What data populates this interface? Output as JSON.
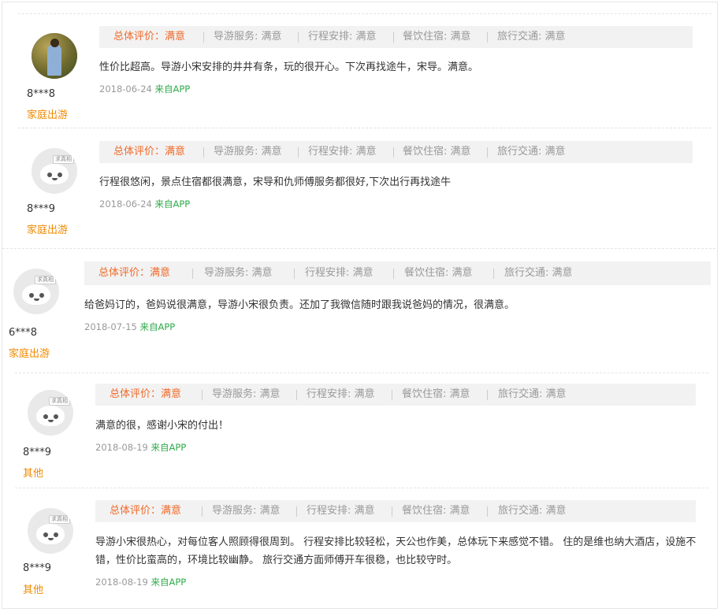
{
  "reviews": [
    {
      "avatar": "user-photo",
      "name": "8***8",
      "type": "家庭出游",
      "ratings": {
        "overall": "总体评价：满意",
        "guide": "导游服务: 满意",
        "itinerary": "行程安排: 满意",
        "dining": "餐饮住宿: 满意",
        "transport": "旅行交通: 满意"
      },
      "content": "性价比超高。导游小宋安排的井井有条，玩的很开心。下次再找途牛，宋导。满意。",
      "date": "2018-06-24",
      "source": "来自APP"
    },
    {
      "avatar": "default-cow",
      "avatar_tag": "求真相",
      "name": "8***9",
      "type": "家庭出游",
      "ratings": {
        "overall": "总体评价：满意",
        "guide": "导游服务: 满意",
        "itinerary": "行程安排: 满意",
        "dining": "餐饮住宿: 满意",
        "transport": "旅行交通: 满意"
      },
      "content": "行程很悠闲，景点住宿都很满意，宋导和仇师傅服务都很好,下次出行再找途牛",
      "date": "2018-06-24",
      "source": "来自APP"
    },
    {
      "avatar": "default-cow",
      "avatar_tag": "求真相",
      "name": "6***8",
      "type": "家庭出游",
      "ratings": {
        "overall": "总体评价：满意",
        "guide": "导游服务: 满意",
        "itinerary": "行程安排: 满意",
        "dining": "餐饮住宿: 满意",
        "transport": "旅行交通: 满意"
      },
      "content": "给爸妈订的，爸妈说很满意，导游小宋很负责。还加了我微信随时跟我说爸妈的情况，很满意。",
      "date": "2018-07-15",
      "source": "来自APP"
    },
    {
      "avatar": "default-cow",
      "avatar_tag": "求真相",
      "name": "8***9",
      "type": "其他",
      "ratings": {
        "overall": "总体评价：满意",
        "guide": "导游服务: 满意",
        "itinerary": "行程安排: 满意",
        "dining": "餐饮住宿: 满意",
        "transport": "旅行交通: 满意"
      },
      "content": "满意的很，感谢小宋的付出！",
      "date": "2018-08-19",
      "source": "来自APP"
    },
    {
      "avatar": "default-cow",
      "avatar_tag": "求真相",
      "name": "8***9",
      "type": "其他",
      "ratings": {
        "overall": "总体评价：满意",
        "guide": "导游服务: 满意",
        "itinerary": "行程安排: 满意",
        "dining": "餐饮住宿: 满意",
        "transport": "旅行交通: 满意"
      },
      "content": "导游小宋很热心，对每位客人照顾得很周到。 行程安排比较轻松，天公也作美，总体玩下来感觉不错。 住的是维也纳大酒店，设施不错，性价比蛮高的，环境比较幽静。 旅行交通方面师傅开车很稳，也比较守时。",
      "date": "2018-08-19",
      "source": "来自APP"
    }
  ]
}
